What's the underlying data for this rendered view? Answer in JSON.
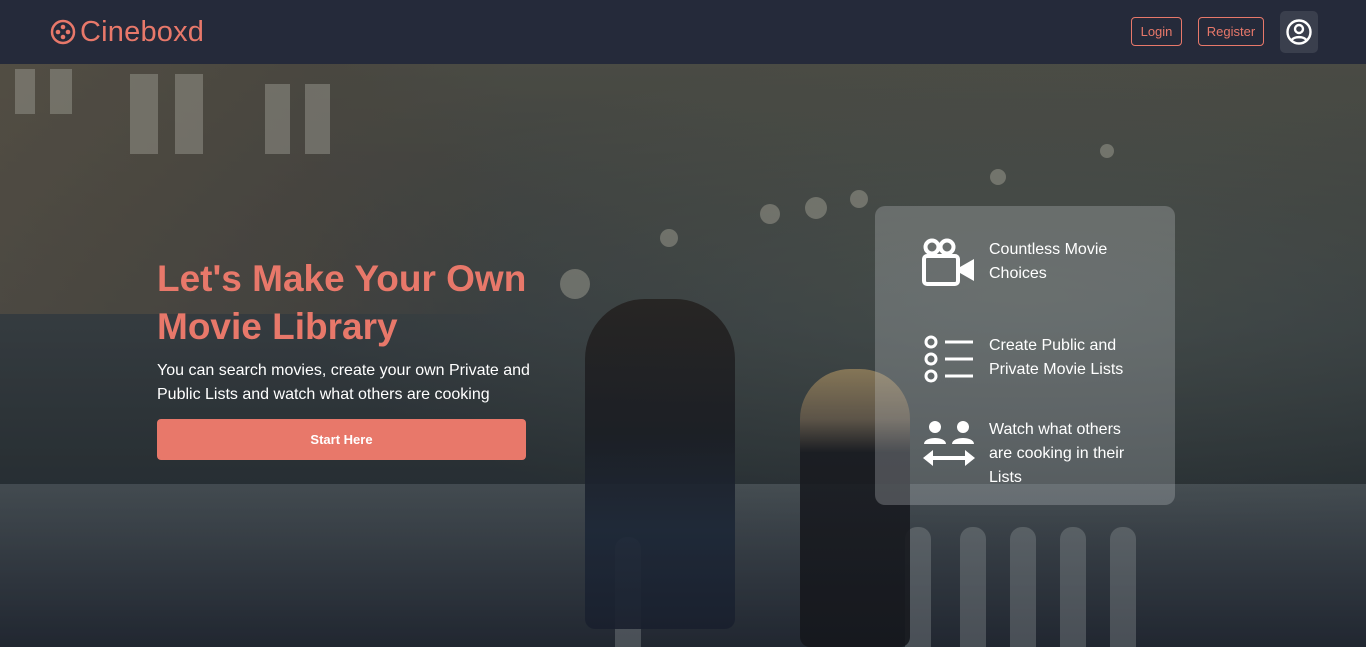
{
  "brand": {
    "name": "Cineboxd"
  },
  "nav": {
    "login_label": "Login",
    "register_label": "Register"
  },
  "hero": {
    "title": "Let's Make Your Own Movie Library",
    "subtitle": "You can search movies, create your own Private and Public Lists and watch what others are cooking",
    "cta_label": "Start Here"
  },
  "features": [
    {
      "icon": "video-camera-icon",
      "text": "Countless Movie Choices"
    },
    {
      "icon": "list-icon",
      "text": "Create Public and Private Movie Lists"
    },
    {
      "icon": "users-exchange-icon",
      "text": "Watch what others are cooking in their Lists"
    }
  ],
  "colors": {
    "accent": "#e8786a",
    "navbar": "#252a3a",
    "text": "#ffffff"
  }
}
